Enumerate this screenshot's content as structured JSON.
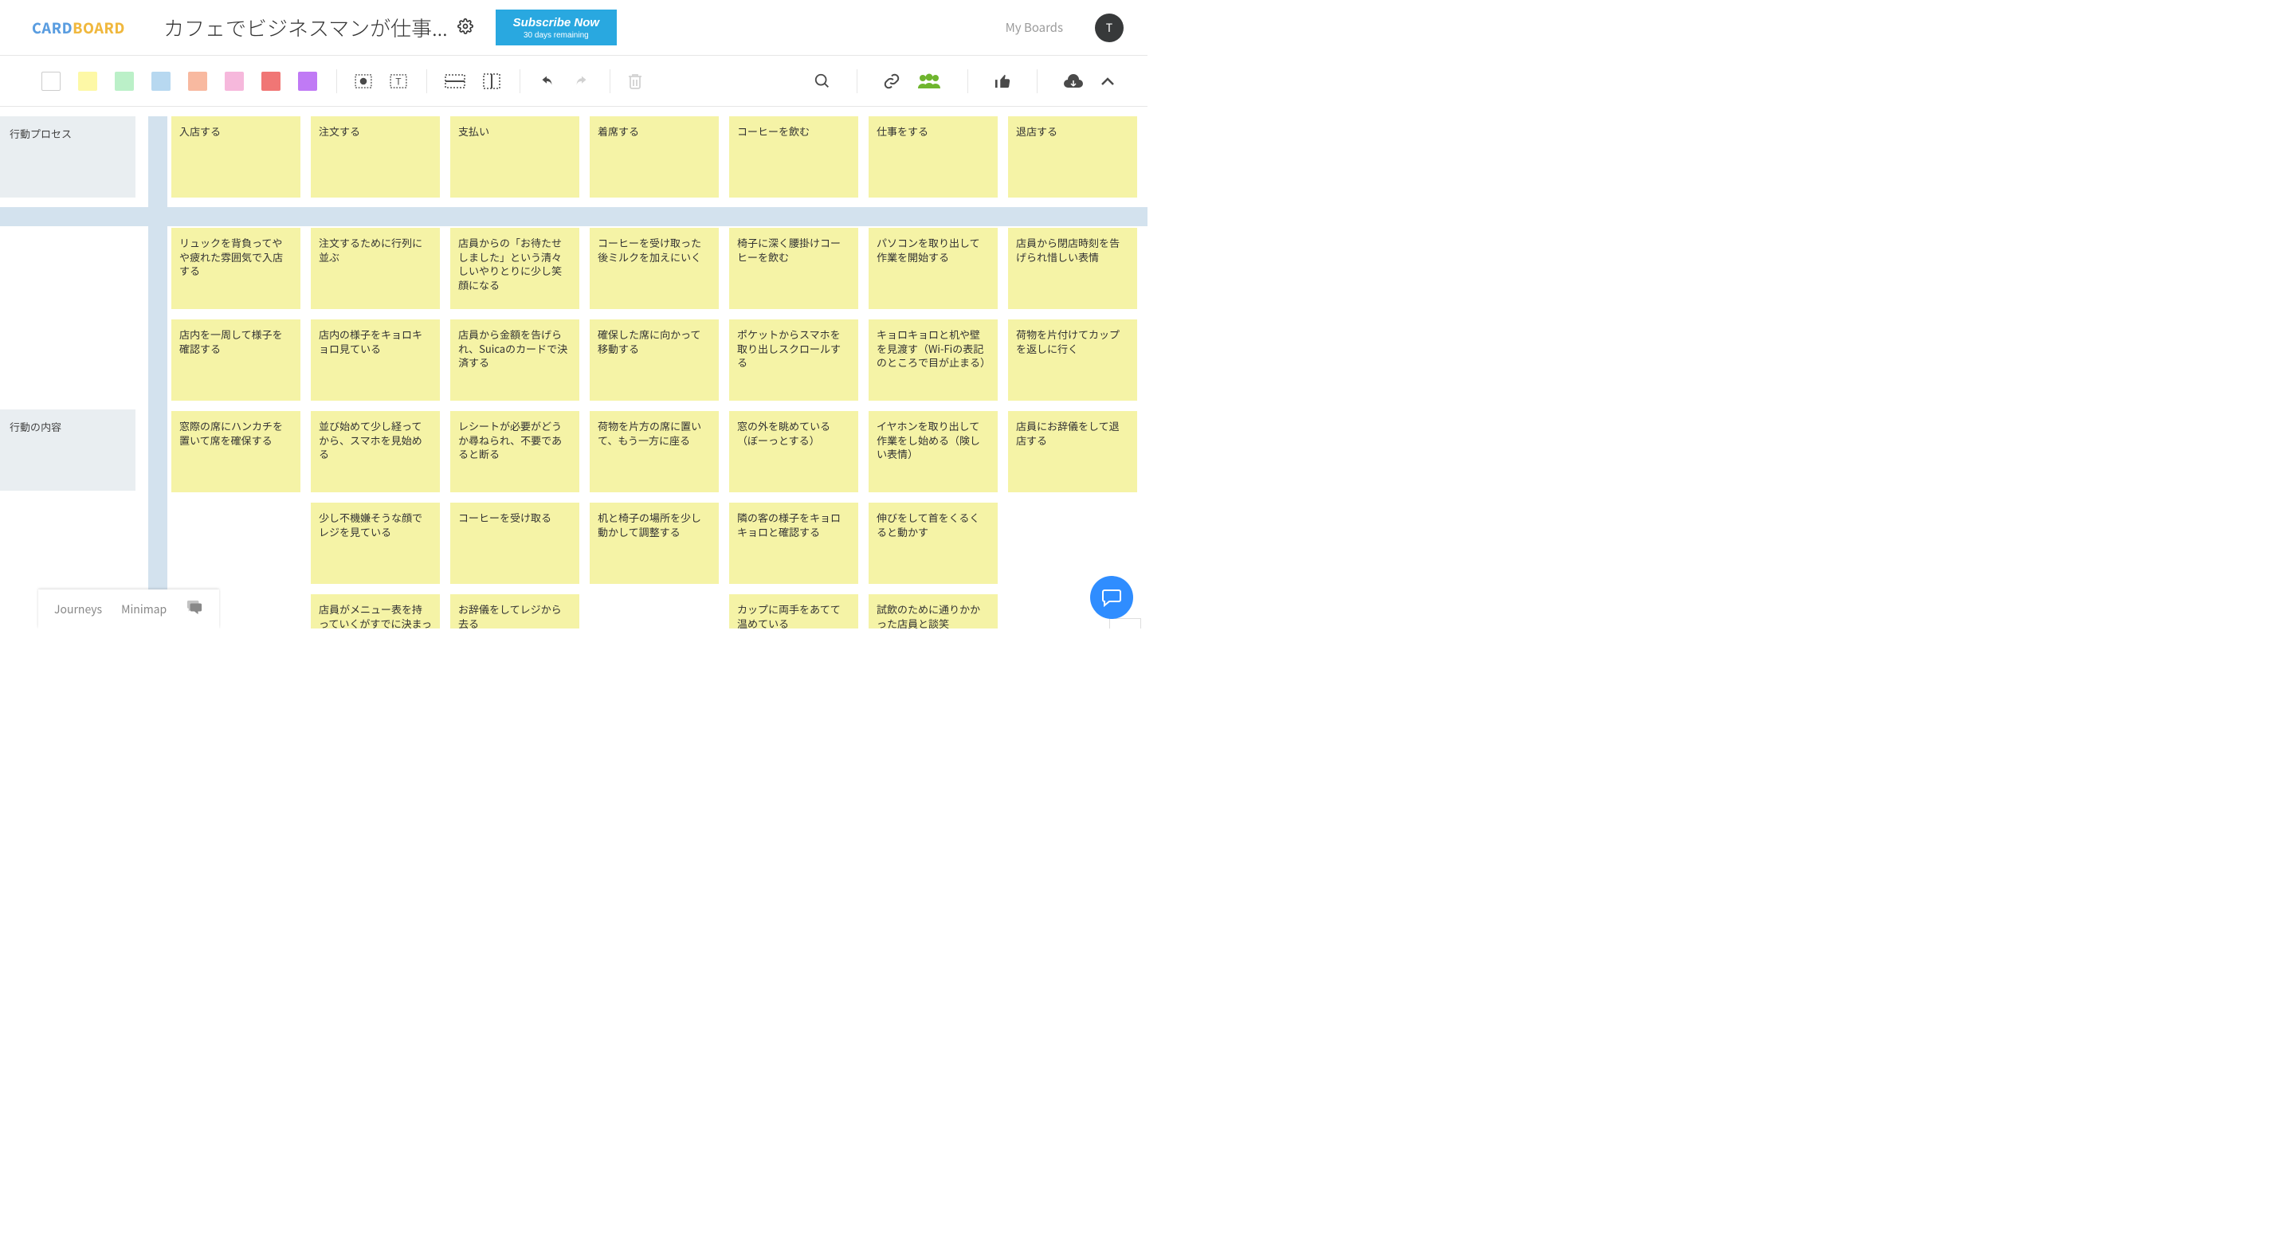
{
  "header": {
    "logo_part1": "CARD",
    "logo_part2": "BOARD",
    "board_title": "カフェでビジネスマンが仕事...",
    "subscribe_label": "Subscribe Now",
    "subscribe_sub": "30 days remaining",
    "my_boards": "My Boards",
    "avatar_initial": "T"
  },
  "toolbar": {
    "colors": [
      "#ffffff",
      "#fdf8a6",
      "#bbf0c8",
      "#b7d8f0",
      "#f8b9a0",
      "#f6b8dc",
      "#f07675",
      "#c07af5"
    ]
  },
  "rows": [
    {
      "label": "行動プロセス"
    },
    {
      "label": "行動の内容"
    }
  ],
  "columns": [
    {
      "header": "入店する"
    },
    {
      "header": "注文する"
    },
    {
      "header": "支払い"
    },
    {
      "header": "着席する"
    },
    {
      "header": "コーヒーを飲む"
    },
    {
      "header": "仕事をする"
    },
    {
      "header": "退店する"
    }
  ],
  "cards": [
    {
      "col": 0,
      "r": 0,
      "text": "リュックを背負ってやや疲れた雰囲気で入店する"
    },
    {
      "col": 0,
      "r": 1,
      "text": "店内を一周して様子を確認する"
    },
    {
      "col": 0,
      "r": 2,
      "text": "窓際の席にハンカチを置いて席を確保する"
    },
    {
      "col": 1,
      "r": 0,
      "text": "注文するために行列に並ぶ"
    },
    {
      "col": 1,
      "r": 1,
      "text": "店内の様子をキョロキョロ見ている"
    },
    {
      "col": 1,
      "r": 2,
      "text": "並び始めて少し経ってから、スマホを見始める"
    },
    {
      "col": 1,
      "r": 3,
      "text": "少し不機嫌そうな顔でレジを見ている"
    },
    {
      "col": 1,
      "r": 4,
      "text": "店員がメニュー表を持っていくがすでに決まっているという様子を見せる"
    },
    {
      "col": 2,
      "r": 0,
      "text": "店員からの「お待たせしました」という清々しいやりとりに少し笑顔になる"
    },
    {
      "col": 2,
      "r": 1,
      "text": "店員から金額を告げられ、Suicaのカードで決済する"
    },
    {
      "col": 2,
      "r": 2,
      "text": "レシートが必要がどうか尋ねられ、不要であると断る"
    },
    {
      "col": 2,
      "r": 3,
      "text": "コーヒーを受け取る"
    },
    {
      "col": 2,
      "r": 4,
      "text": "お辞儀をしてレジから去る"
    },
    {
      "col": 3,
      "r": 0,
      "text": "コーヒーを受け取った後ミルクを加えにいく"
    },
    {
      "col": 3,
      "r": 1,
      "text": "確保した席に向かって移動する"
    },
    {
      "col": 3,
      "r": 2,
      "text": "荷物を片方の席に置いて、もう一方に座る"
    },
    {
      "col": 3,
      "r": 3,
      "text": "机と椅子の場所を少し動かして調整する"
    },
    {
      "col": 4,
      "r": 0,
      "text": "椅子に深く腰掛けコーヒーを飲む"
    },
    {
      "col": 4,
      "r": 1,
      "text": "ポケットからスマホを取り出しスクロールする"
    },
    {
      "col": 4,
      "r": 2,
      "text": "窓の外を眺めている（ぼーっとする）"
    },
    {
      "col": 4,
      "r": 3,
      "text": "隣の客の様子をキョロキョロと確認する"
    },
    {
      "col": 4,
      "r": 4,
      "text": "カップに両手をあてて温めている"
    },
    {
      "col": 5,
      "r": 0,
      "text": "パソコンを取り出して作業を開始する"
    },
    {
      "col": 5,
      "r": 1,
      "text": "キョロキョロと机や壁を見渡す（Wi-Fiの表記のところで目が止まる）"
    },
    {
      "col": 5,
      "r": 2,
      "text": "イヤホンを取り出して作業をし始める（険しい表情）"
    },
    {
      "col": 5,
      "r": 3,
      "text": "伸びをして首をくるくると動かす"
    },
    {
      "col": 5,
      "r": 4,
      "text": "試飲のために通りかかった店員と談笑"
    },
    {
      "col": 6,
      "r": 0,
      "text": "店員から閉店時刻を告げられ惜しい表情"
    },
    {
      "col": 6,
      "r": 1,
      "text": "荷物を片付けてカップを返しに行く"
    },
    {
      "col": 6,
      "r": 2,
      "text": "店員にお辞儀をして退店する"
    }
  ],
  "bottom": {
    "journeys": "Journeys",
    "minimap": "Minimap"
  },
  "zoom": {
    "plus": "+",
    "minus": "−"
  }
}
